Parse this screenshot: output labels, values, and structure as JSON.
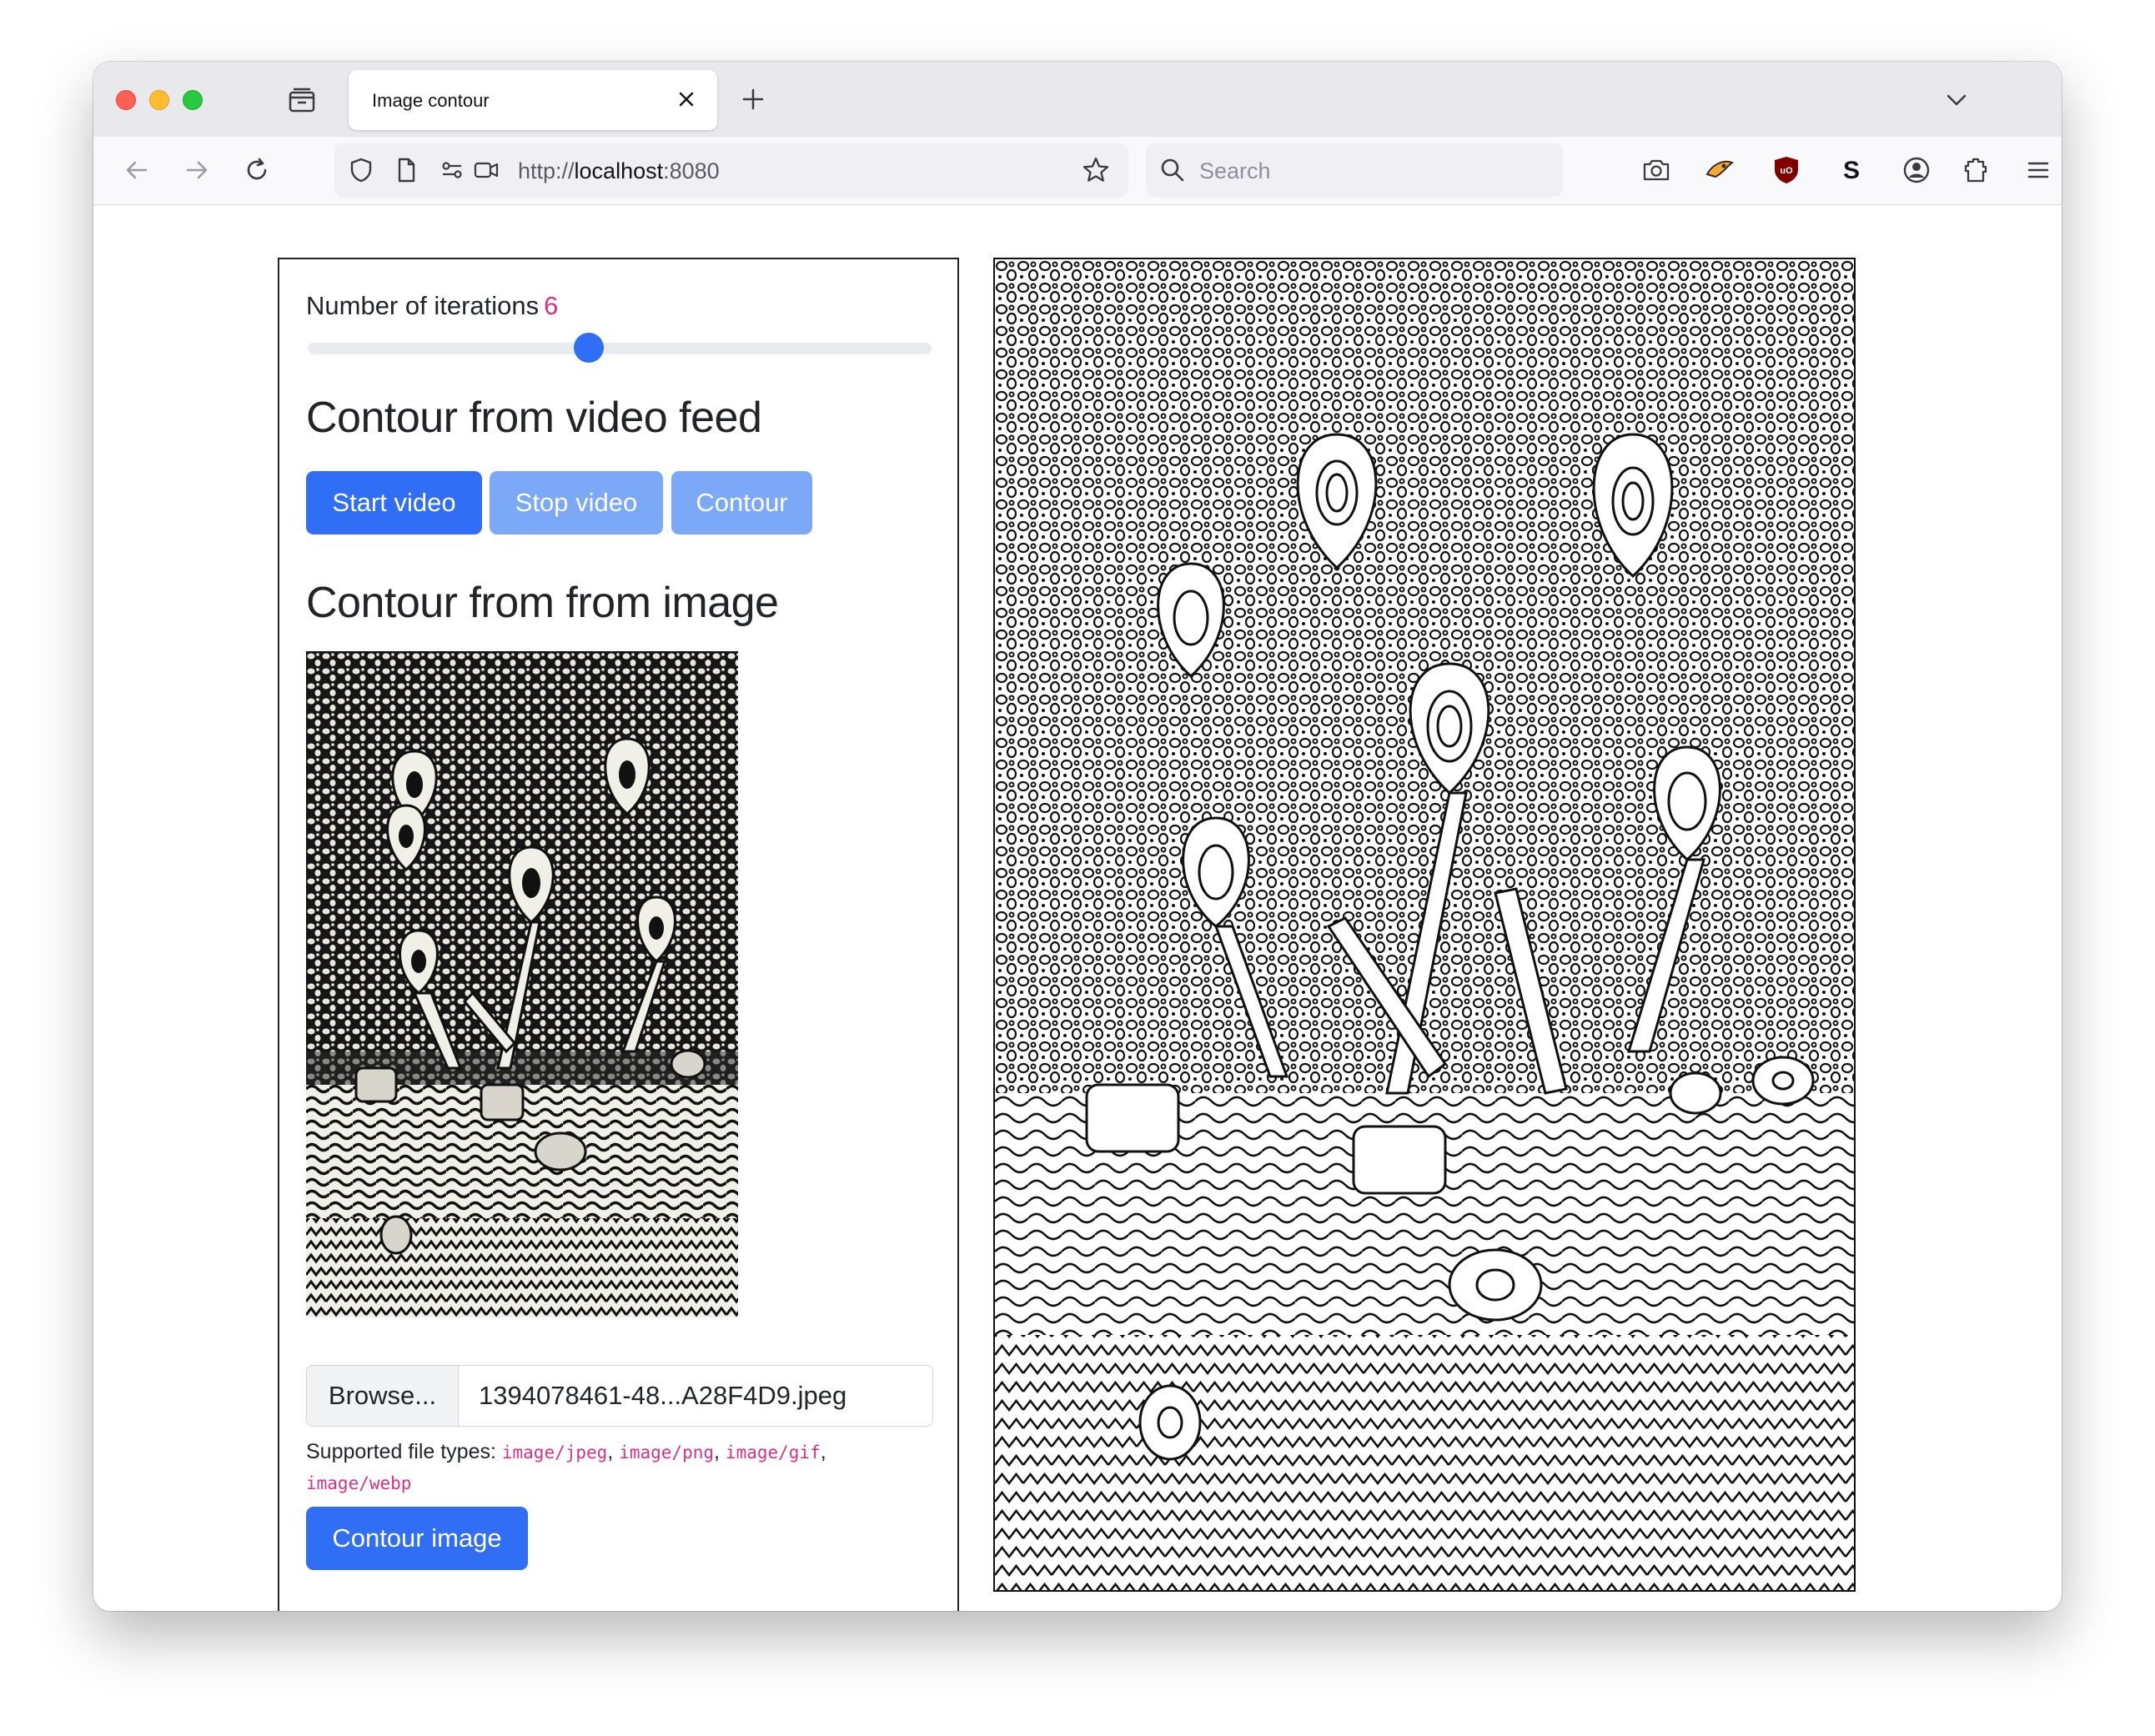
{
  "browser": {
    "tab_title": "Image contour",
    "url_scheme": "http://",
    "url_host": "localhost",
    "url_rest": ":8080",
    "search_placeholder": "Search",
    "icons": [
      "tab-groups-icon",
      "close-icon",
      "plus-icon",
      "chevron-down-icon",
      "back-arrow-icon",
      "forward-arrow-icon",
      "reload-icon",
      "shield-icon",
      "page-icon",
      "permissions-icon",
      "camera-permission-icon",
      "bookmark-star-icon",
      "search-icon",
      "screenshot-icon",
      "extension-fox-icon",
      "ublock-icon",
      "s-extension-icon",
      "account-icon",
      "extensions-puzzle-icon",
      "menu-icon"
    ]
  },
  "controls": {
    "iterations_label": "Number of iterations",
    "iterations_value": "6",
    "slider_fraction": 0.45
  },
  "video_section": {
    "heading": "Contour from video feed",
    "start_label": "Start video",
    "stop_label": "Stop video",
    "contour_label": "Contour"
  },
  "image_section": {
    "heading": "Contour from from image",
    "browse_label": "Browse...",
    "file_name": "1394078461-48...A28F4D9.jpeg",
    "help_prefix": "Supported file types:",
    "types": [
      "image/jpeg",
      "image/png",
      "image/gif",
      "image/webp"
    ],
    "contour_image_label": "Contour image"
  },
  "colors": {
    "primary": "#2f6ef5",
    "disabled": "#7ca8f8",
    "accent_value": "#d63384"
  }
}
